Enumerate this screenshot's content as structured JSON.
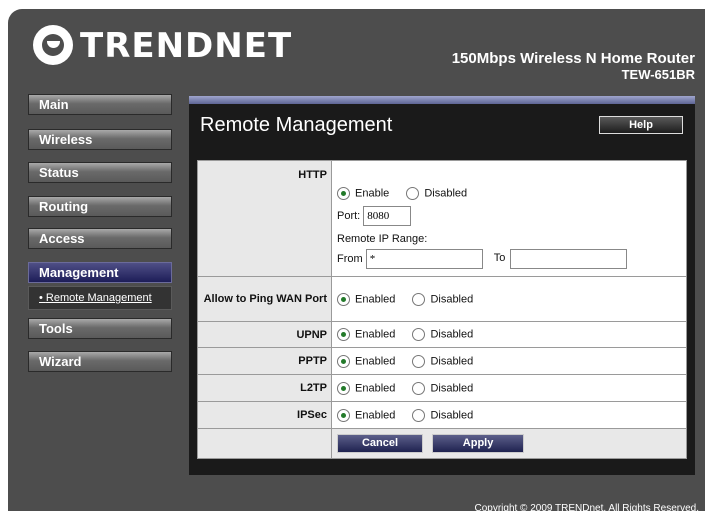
{
  "header": {
    "brand": "TRENDNET",
    "product": "150Mbps Wireless N Home Router",
    "model": "TEW-651BR"
  },
  "nav": {
    "items": [
      {
        "label": "Main"
      },
      {
        "label": "Wireless"
      },
      {
        "label": "Status"
      },
      {
        "label": "Routing"
      },
      {
        "label": "Access"
      },
      {
        "label": "Management"
      },
      {
        "label": "Tools"
      },
      {
        "label": "Wizard"
      }
    ],
    "sub_item": "Remote Management"
  },
  "page": {
    "title": "Remote Management",
    "help_label": "Help"
  },
  "http": {
    "label": "HTTP",
    "enable_label": "Enable",
    "disabled_label": "Disabled",
    "port_label": "Port:",
    "port_value": "8080",
    "range_label": "Remote IP Range:",
    "from_label": "From",
    "from_value": "*",
    "to_label": "To",
    "to_value": ""
  },
  "ping": {
    "label": "Allow to Ping WAN Port",
    "enabled": "Enabled",
    "disabled": "Disabled"
  },
  "upnp": {
    "label": "UPNP",
    "enabled": "Enabled",
    "disabled": "Disabled"
  },
  "pptp": {
    "label": "PPTP",
    "enabled": "Enabled",
    "disabled": "Disabled"
  },
  "l2tp": {
    "label": "L2TP",
    "enabled": "Enabled",
    "disabled": "Disabled"
  },
  "ipsec": {
    "label": "IPSec",
    "enabled": "Enabled",
    "disabled": "Disabled"
  },
  "actions": {
    "cancel": "Cancel",
    "apply": "Apply"
  },
  "footer": {
    "copyright": "Copyright © 2009 TRENDnet. All Rights Reserved."
  },
  "colors": {
    "frame": "#4d4d4d",
    "panel": "#1a1a1a",
    "active_nav": "#1d1d58",
    "radio_selected": "#237a2a"
  }
}
